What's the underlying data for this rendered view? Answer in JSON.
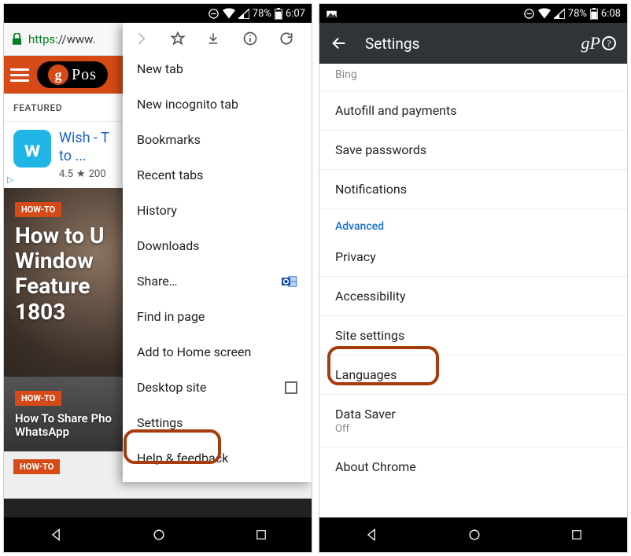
{
  "statusbar": {
    "battery": "78%",
    "time_left": "6:07",
    "time_right": "6:08"
  },
  "phone1": {
    "url_scheme": "https",
    "url_rest": "://www.",
    "site_logo_text": "Pos",
    "featured_label": "FEATURED",
    "ad": {
      "title": "Wish - T",
      "title_line2": "to ...",
      "rating": "4.5",
      "count": "200"
    },
    "article1": {
      "tag": "HOW-TO",
      "headline": "How to U\nWindow\nFeature \n1803"
    },
    "article2": {
      "tag": "HOW-TO",
      "headline": "How To Share Pho\nWhatsApp"
    },
    "article3": {
      "tag": "HOW-TO"
    },
    "menu": {
      "items": [
        "New tab",
        "New incognito tab",
        "Bookmarks",
        "Recent tabs",
        "History",
        "Downloads",
        "Share…",
        "Find in page",
        "Add to Home screen",
        "Desktop site",
        "Settings",
        "Help & feedback"
      ]
    }
  },
  "phone2": {
    "header_title": "Settings",
    "prev_item": "Bing",
    "items_basic": [
      "Autofill and payments",
      "Save passwords",
      "Notifications"
    ],
    "section_advanced": "Advanced",
    "items_advanced": [
      "Privacy",
      "Accessibility",
      "Site settings",
      "Languages"
    ],
    "data_saver_label": "Data Saver",
    "data_saver_sub": "Off",
    "about": "About Chrome"
  }
}
